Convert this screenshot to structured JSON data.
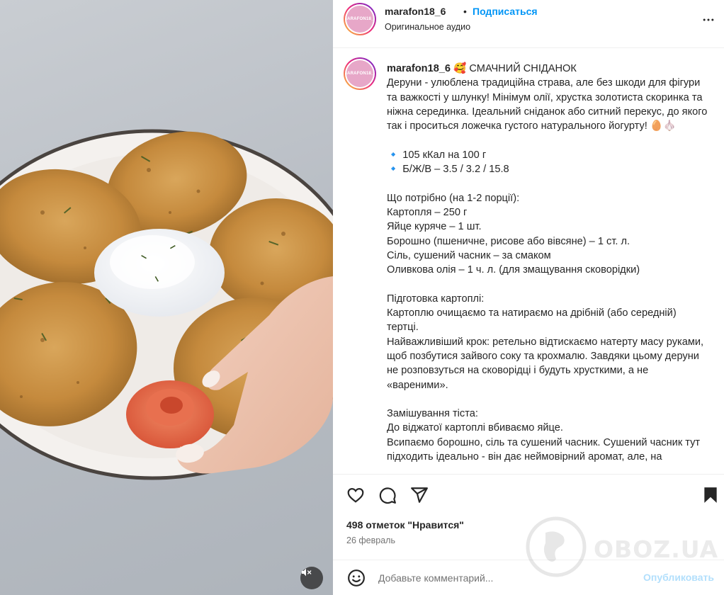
{
  "header": {
    "username": "marafon18_6",
    "dot": "•",
    "follow_label": "Подписаться",
    "audio_label": "Оригинальное аудио",
    "avatar_text": "MARAFON18_6"
  },
  "caption": {
    "username": "marafon18_6",
    "text": "🥰 СМАЧНИЙ СНІДАНОК\nДеруни - улюблена традиційна страва, але без шкоди для фігури та важкості у шлунку! Мінімум олії, хрустка золотиста скоринка та ніжна серединка. Ідеальний сніданок або ситний перекус, до якого так і проситься ложечка густого натурального йогурту! 🥚🧄\n\n🔹 105 кКал на 100 г\n🔹 Б/Ж/В – 3.5 / 3.2 / 15.8\n\nЩо потрібно (на 1-2 порції):\nКартопля – 250 г\nЯйце куряче – 1 шт.\nБорошно (пшеничне, рисове або вівсяне) – 1 ст. л.\nСіль, сушений часник – за смаком\nОливкова олія – 1 ч. л. (для змащування сковорідки)\n\nПідготовка картоплі:\nКартоплю очищаємо та натираємо на дрібній (або середній) тертці.\nНайважливіший крок: ретельно відтискаємо натерту масу руками, щоб позбутися зайвого соку та крохмалю. Завдяки цьому деруни не розповзуться на сковорідці і будуть хрусткими, а не «вареними».\n\nЗамішування тіста:\nДо віджатої картоплі вбиваємо яйце.\nВсипаємо борошно, сіль та сушений часник. Сушений часник тут підходить ідеально - він дає неймовірний аромат, але, на"
  },
  "actions": {
    "likes": "498 отметок \"Нравится\"",
    "date": "26 февраль"
  },
  "comment": {
    "placeholder": "Добавьте комментарий...",
    "post_label": "Опубликовать"
  },
  "watermark": {
    "text": "OBOZ.UA"
  },
  "icons": {
    "like": "heart-icon",
    "comment": "comment-icon",
    "share": "share-icon",
    "save": "bookmark-icon",
    "more": "more-icon",
    "emoji": "emoji-icon",
    "mute": "speaker-muted-icon"
  }
}
